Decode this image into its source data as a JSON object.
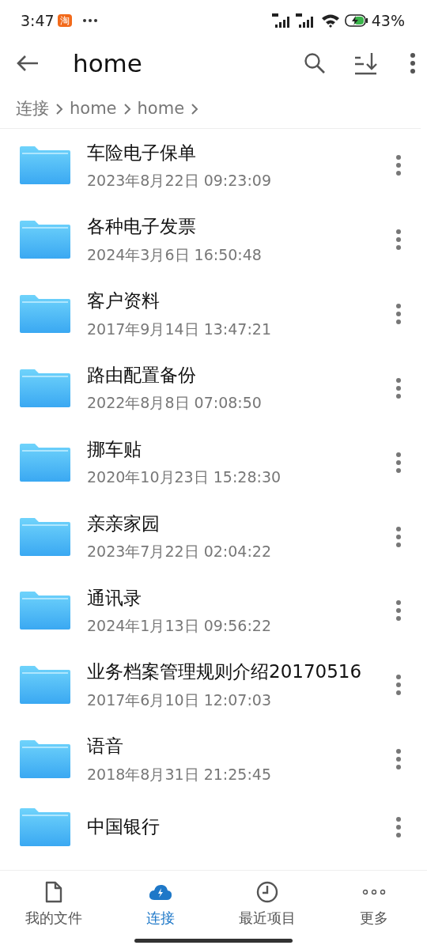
{
  "status_bar": {
    "time": "3:47",
    "app_badge": "淘",
    "battery": "43%"
  },
  "toolbar": {
    "title": "home"
  },
  "breadcrumb": [
    "连接",
    "home",
    "home"
  ],
  "files": [
    {
      "name": "车险电子保单",
      "date": "2023年8月22日 09:23:09"
    },
    {
      "name": "各种电子发票",
      "date": "2024年3月6日 16:50:48"
    },
    {
      "name": "客户资料",
      "date": "2017年9月14日 13:47:21"
    },
    {
      "name": "路由配置备份",
      "date": "2022年8月8日 07:08:50"
    },
    {
      "name": "挪车贴",
      "date": "2020年10月23日 15:28:30"
    },
    {
      "name": "亲亲家园",
      "date": "2023年7月22日 02:04:22"
    },
    {
      "name": "通讯录",
      "date": "2024年1月13日 09:56:22"
    },
    {
      "name": "业务档案管理规则介绍20170516",
      "date": "2017年6月10日 12:07:03"
    },
    {
      "name": "语音",
      "date": "2018年8月31日 21:25:45"
    },
    {
      "name": "中国银行"
    }
  ],
  "bottom_nav": [
    {
      "kind": "file",
      "label": "我的文件",
      "selected": false
    },
    {
      "kind": "cloud",
      "label": "连接",
      "selected": true
    },
    {
      "kind": "clock",
      "label": "最近项目",
      "selected": false
    },
    {
      "kind": "more",
      "label": "更多",
      "selected": false
    }
  ]
}
